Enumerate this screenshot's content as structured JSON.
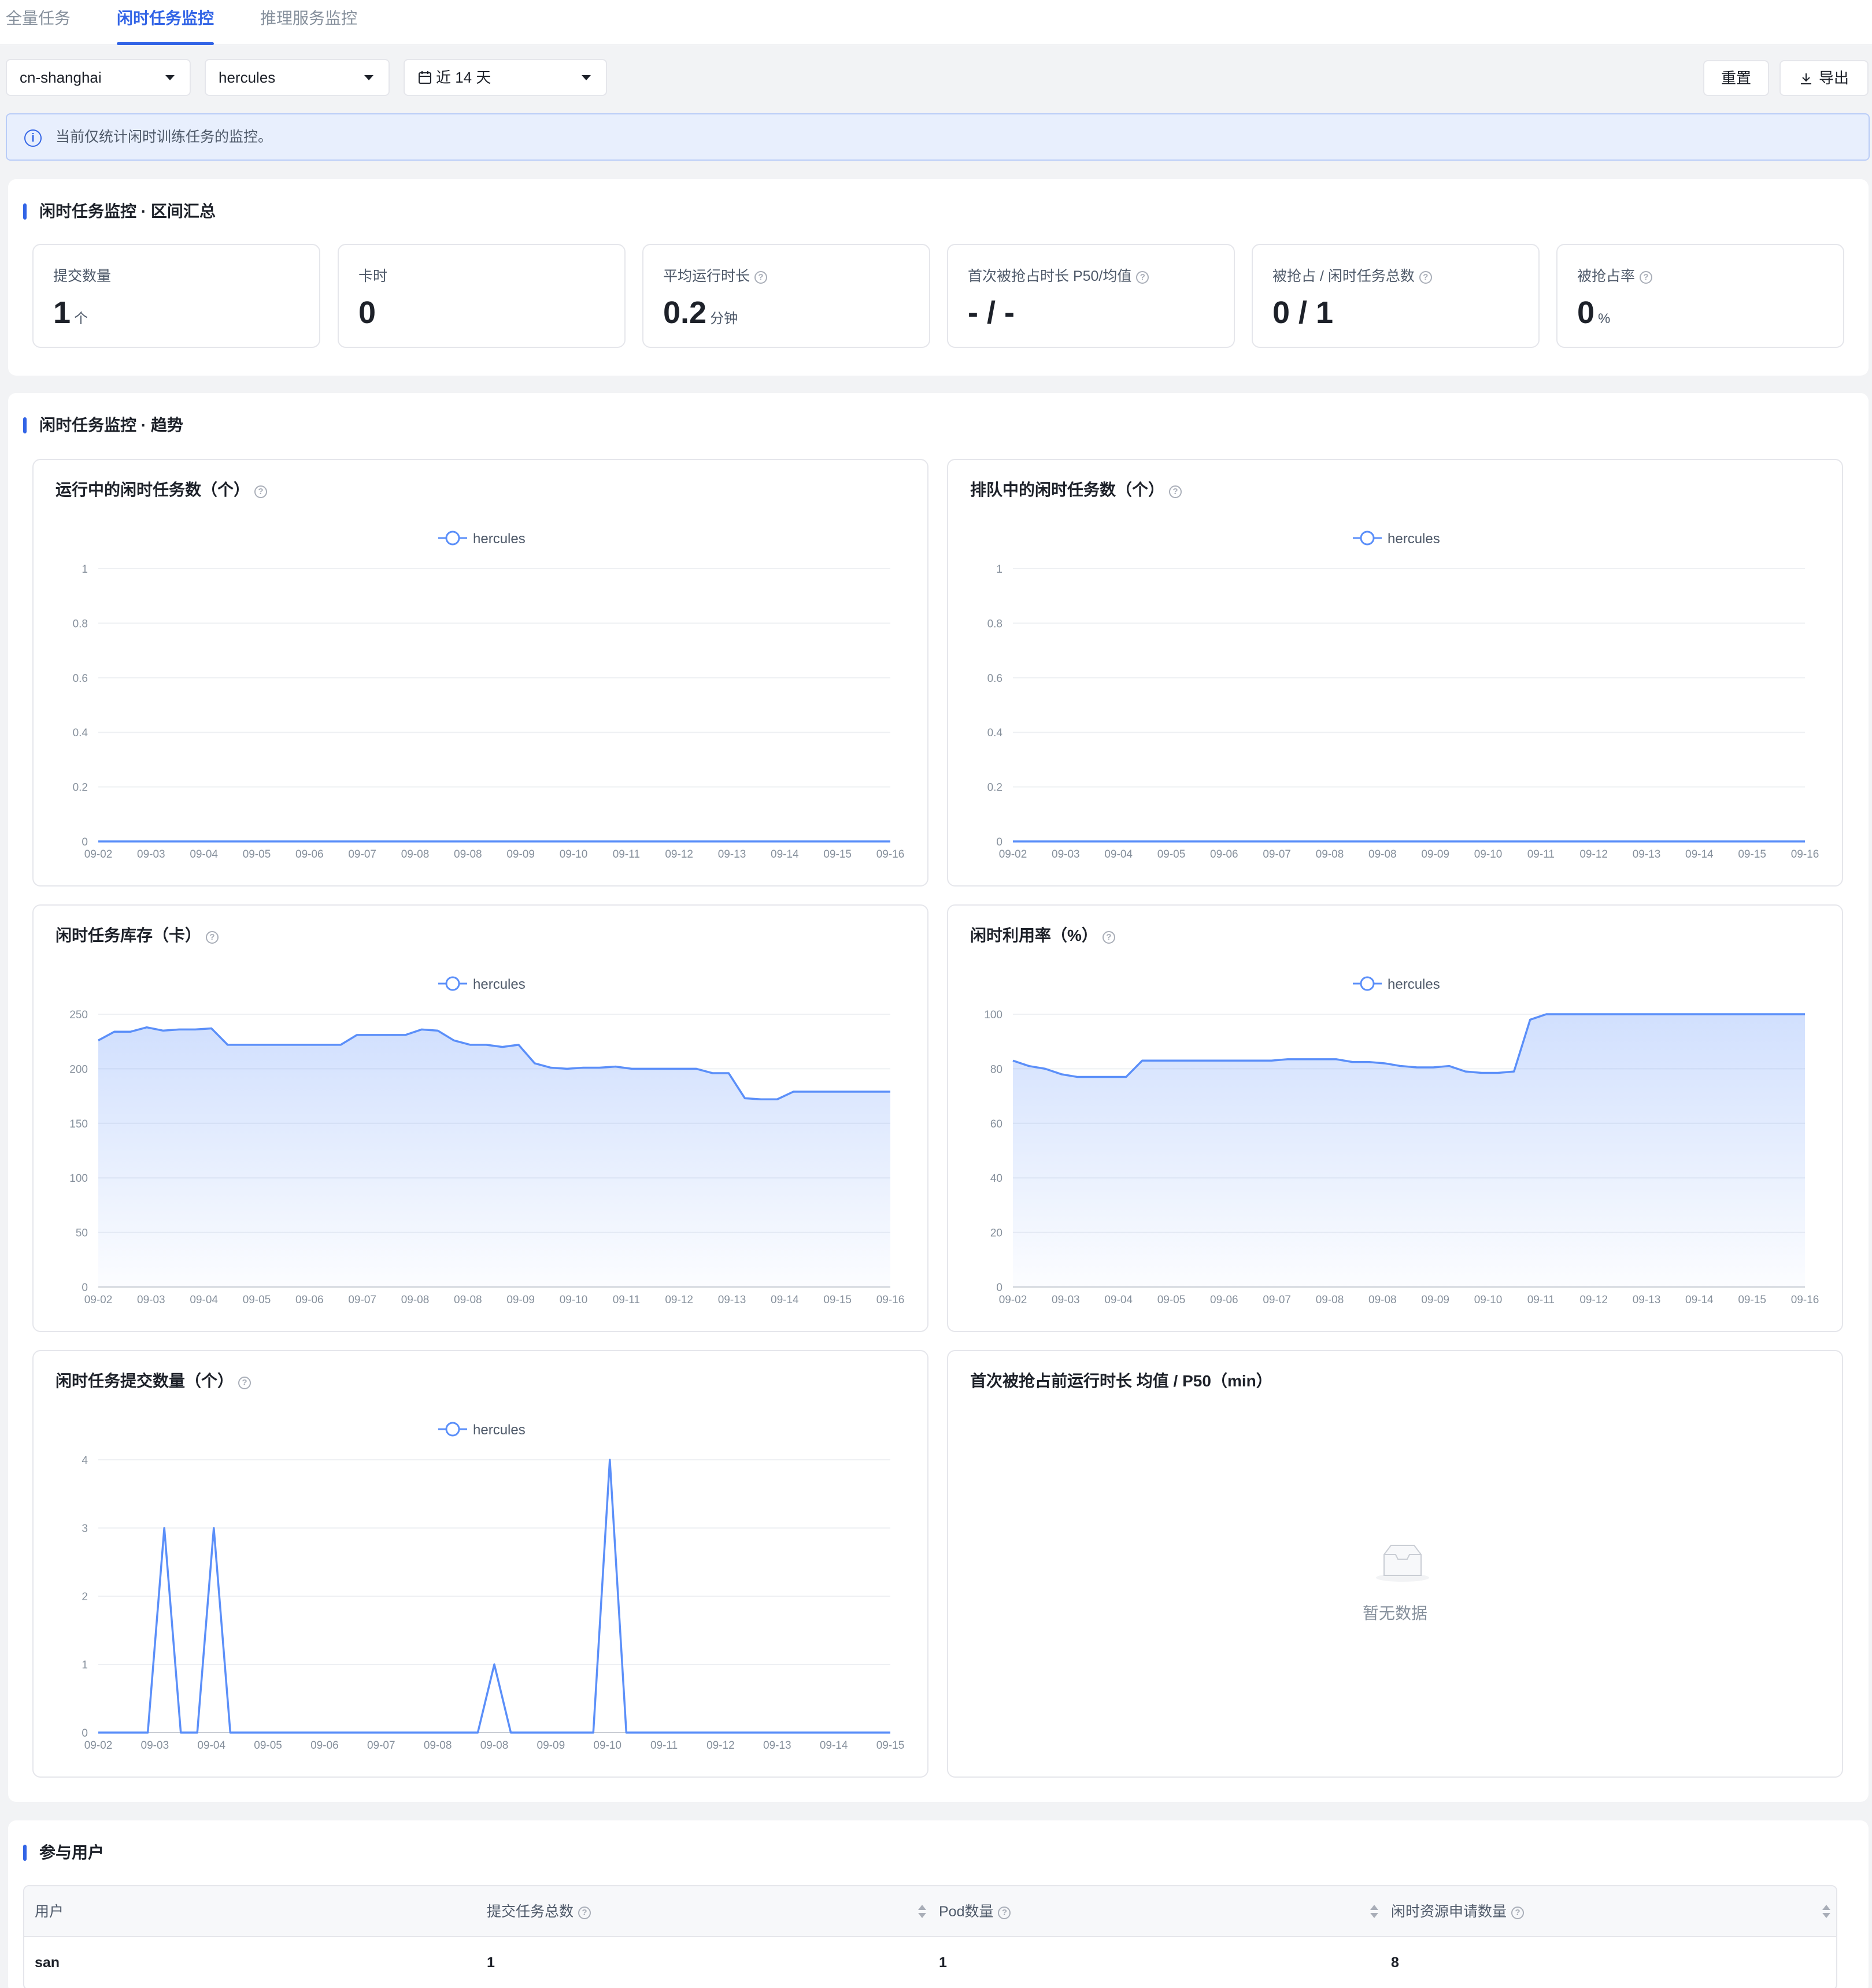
{
  "tabs": [
    {
      "label": "全量任务",
      "active": false
    },
    {
      "label": "闲时任务监控",
      "active": true
    },
    {
      "label": "推理服务监控",
      "active": false
    }
  ],
  "filters": {
    "region": "cn-shanghai",
    "cluster": "hercules",
    "range": "近 14 天"
  },
  "actions": {
    "reset": "重置",
    "export": "导出"
  },
  "alert": "当前仅统计闲时训练任务的监控。",
  "summary": {
    "title": "闲时任务监控 · 区间汇总",
    "stats": [
      {
        "label": "提交数量",
        "value": "1",
        "unit": "个",
        "help": false
      },
      {
        "label": "卡时",
        "value": "0",
        "unit": "",
        "help": false
      },
      {
        "label": "平均运行时长",
        "value": "0.2",
        "unit": "分钟",
        "help": true
      },
      {
        "label": "首次被抢占时长 P50/均值",
        "value": "- / -",
        "unit": "",
        "help": true
      },
      {
        "label": "被抢占 / 闲时任务总数",
        "value": "0 / 1",
        "unit": "",
        "help": true
      },
      {
        "label": "被抢占率",
        "value": "0",
        "unit": "%",
        "help": true
      }
    ]
  },
  "trend": {
    "title": "闲时任务监控 · 趋势",
    "empty_text": "暂无数据"
  },
  "chart_data": [
    {
      "type": "line",
      "title": "运行中的闲时任务数（个）",
      "x": [
        "09-02",
        "09-03",
        "09-04",
        "09-05",
        "09-06",
        "09-07",
        "09-08",
        "09-08",
        "09-09",
        "09-10",
        "09-11",
        "09-12",
        "09-13",
        "09-14",
        "09-15",
        "09-16"
      ],
      "series": [
        {
          "name": "hercules",
          "values": [
            0,
            0,
            0,
            0,
            0,
            0,
            0,
            0,
            0,
            0,
            0,
            0,
            0,
            0,
            0,
            0
          ]
        }
      ],
      "yticks": [
        "0",
        "0.2",
        "0.4",
        "0.6",
        "0.8",
        "1"
      ],
      "ylim": [
        0,
        1
      ],
      "area": false,
      "grid": true,
      "legend": "top-center",
      "color": "#5b8ff9"
    },
    {
      "type": "line",
      "title": "排队中的闲时任务数（个）",
      "x": [
        "09-02",
        "09-03",
        "09-04",
        "09-05",
        "09-06",
        "09-07",
        "09-08",
        "09-08",
        "09-09",
        "09-10",
        "09-11",
        "09-12",
        "09-13",
        "09-14",
        "09-15",
        "09-16"
      ],
      "series": [
        {
          "name": "hercules",
          "values": [
            0,
            0,
            0,
            0,
            0,
            0,
            0,
            0,
            0,
            0,
            0,
            0,
            0,
            0,
            0,
            0
          ]
        }
      ],
      "yticks": [
        "0",
        "0.2",
        "0.4",
        "0.6",
        "0.8",
        "1"
      ],
      "ylim": [
        0,
        1
      ],
      "area": false,
      "grid": true,
      "legend": "top-center",
      "color": "#5b8ff9"
    },
    {
      "type": "area",
      "title": "闲时任务库存（卡）",
      "x": [
        "09-02",
        "09-03",
        "09-04",
        "09-05",
        "09-06",
        "09-07",
        "09-08",
        "09-08",
        "09-09",
        "09-10",
        "09-11",
        "09-12",
        "09-13",
        "09-14",
        "09-15",
        "09-16"
      ],
      "series": [
        {
          "name": "hercules",
          "values": [
            226,
            234,
            234,
            238,
            235,
            236,
            236,
            237,
            222,
            222,
            222,
            222,
            222,
            222,
            222,
            222,
            231,
            231,
            231,
            231,
            236,
            235,
            226,
            222,
            222,
            220,
            222,
            205,
            201,
            200,
            201,
            201,
            202,
            200,
            200,
            200,
            200,
            200,
            196,
            196,
            173,
            172,
            172,
            179,
            179,
            179,
            179,
            179,
            179,
            179
          ]
        }
      ],
      "yticks": [
        "0",
        "50",
        "100",
        "150",
        "200",
        "250"
      ],
      "ylim": [
        0,
        250
      ],
      "area": true,
      "grid": true,
      "legend": "top-center",
      "color": "#5b8ff9"
    },
    {
      "type": "area",
      "title": "闲时利用率（%）",
      "x": [
        "09-02",
        "09-03",
        "09-04",
        "09-05",
        "09-06",
        "09-07",
        "09-08",
        "09-08",
        "09-09",
        "09-10",
        "09-11",
        "09-12",
        "09-13",
        "09-14",
        "09-15",
        "09-16"
      ],
      "series": [
        {
          "name": "hercules",
          "values": [
            83,
            81,
            80,
            78,
            77,
            77,
            77,
            77,
            83,
            83,
            83,
            83,
            83,
            83,
            83,
            83,
            83,
            83.5,
            83.5,
            83.5,
            83.5,
            82.5,
            82.5,
            82,
            81,
            80.5,
            80.5,
            81,
            79,
            78.5,
            78.5,
            79,
            98,
            100,
            100,
            100,
            100,
            100,
            100,
            100,
            100,
            100,
            100,
            100,
            100,
            100,
            100,
            100,
            100,
            100
          ]
        }
      ],
      "yticks": [
        "0",
        "20",
        "40",
        "60",
        "80",
        "100"
      ],
      "ylim": [
        0,
        100
      ],
      "area": true,
      "grid": true,
      "legend": "top-center",
      "color": "#5b8ff9"
    },
    {
      "type": "line",
      "title": "闲时任务提交数量（个）",
      "x": [
        "09-02",
        "09-03",
        "09-04",
        "09-05",
        "09-06",
        "09-07",
        "09-08",
        "09-08",
        "09-09",
        "09-10",
        "09-11",
        "09-12",
        "09-13",
        "09-14",
        "09-15"
      ],
      "series": [
        {
          "name": "hercules",
          "values": [
            0,
            0,
            0,
            0,
            3,
            0,
            0,
            3,
            0,
            0,
            0,
            0,
            0,
            0,
            0,
            0,
            0,
            0,
            0,
            0,
            0,
            0,
            0,
            0,
            1,
            0,
            0,
            0,
            0,
            0,
            0,
            4,
            0,
            0,
            0,
            0,
            0,
            0,
            0,
            0,
            0,
            0,
            0,
            0,
            0,
            0,
            0,
            0,
            0
          ]
        }
      ],
      "yticks": [
        "0",
        "1",
        "2",
        "3",
        "4"
      ],
      "ylim": [
        0,
        4
      ],
      "area": false,
      "grid": true,
      "legend": "top-center",
      "color": "#5b8ff9"
    },
    {
      "type": "line",
      "title": "首次被抢占前运行时长 均值 / P50（min）",
      "series": [],
      "empty": true
    }
  ],
  "users": {
    "title": "参与用户",
    "columns": [
      {
        "label": "用户",
        "help": false,
        "sortable": false
      },
      {
        "label": "提交任务总数",
        "help": true,
        "sortable": true
      },
      {
        "label": "Pod数量",
        "help": true,
        "sortable": true
      },
      {
        "label": "闲时资源申请数量",
        "help": true,
        "sortable": true
      }
    ],
    "rows": [
      [
        "san",
        "1",
        "1",
        "8"
      ]
    ]
  }
}
